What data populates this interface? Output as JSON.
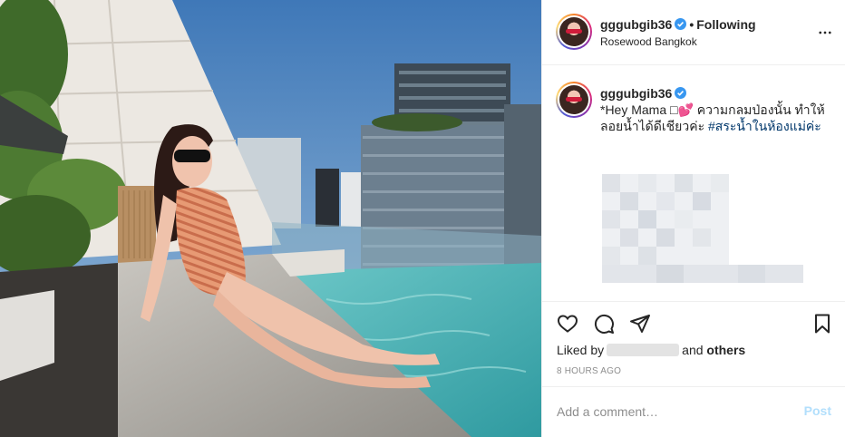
{
  "post": {
    "username": "gggubgib36",
    "follow_status": "Following",
    "location": "Rosewood Bangkok",
    "caption_prefix": "*Hey Mama",
    "caption_emoji": "□💕",
    "caption_text": " ความกลมป่องนั้น ทำให้ลอยน้ำได้ดีเชียวค่ะ ",
    "caption_hashtag": "#สระน้ำในห้องแม่ค่ะ",
    "liked_by_label": "Liked by",
    "liked_and": "and",
    "liked_others": "others",
    "timestamp": "8 hours ago"
  },
  "comment": {
    "placeholder": "Add a comment…",
    "post_label": "Post"
  },
  "icons": {
    "verified": "verified-badge-icon",
    "more": "more-options-icon",
    "like": "heart-icon",
    "comment": "comment-icon",
    "share": "share-icon",
    "save": "bookmark-icon"
  },
  "colors": {
    "verified_blue": "#3897f0",
    "hashtag": "#00376b",
    "post_disabled": "#b2dffc",
    "muted": "#8e8e8e"
  }
}
